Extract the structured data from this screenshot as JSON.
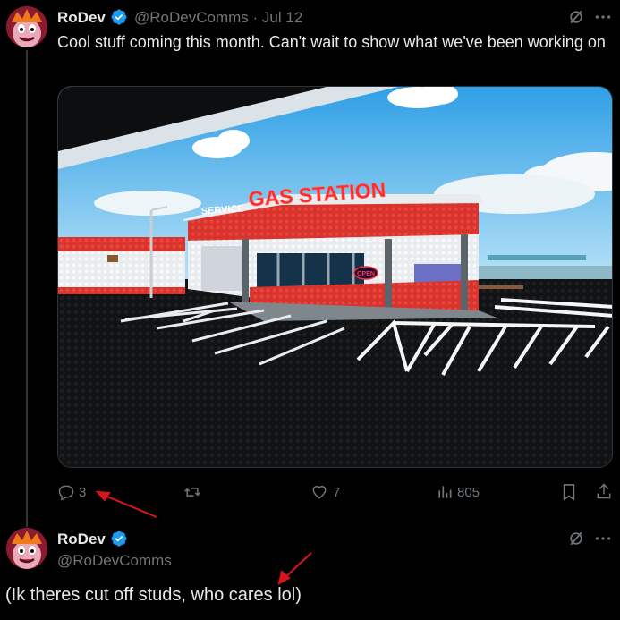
{
  "tweet": {
    "author_name": "RoDev",
    "author_handle": "@RoDevComms",
    "separator": "·",
    "date": "Jul 12",
    "text": "Cool stuff coming this month. Can't wait to show what we've been working on",
    "media": {
      "sign_text": "GAS STATION",
      "small_sign_text": "SERVICE",
      "open_sign_text": "OPEN"
    },
    "actions": {
      "replies": "3",
      "reposts": "",
      "likes": "7",
      "views": "805"
    }
  },
  "reply": {
    "author_name": "RoDev",
    "author_handle": "@RoDevComms",
    "text": "(Ik theres cut off studs, who cares lol)"
  },
  "colors": {
    "verified": "#1d9bf0",
    "annotation_arrow": "#d9141b",
    "muted": "#71767b"
  },
  "icons": [
    "grok-icon",
    "more-icon",
    "reply-icon",
    "repost-icon",
    "like-icon",
    "views-icon",
    "bookmark-icon",
    "share-icon",
    "verified-badge-icon"
  ]
}
